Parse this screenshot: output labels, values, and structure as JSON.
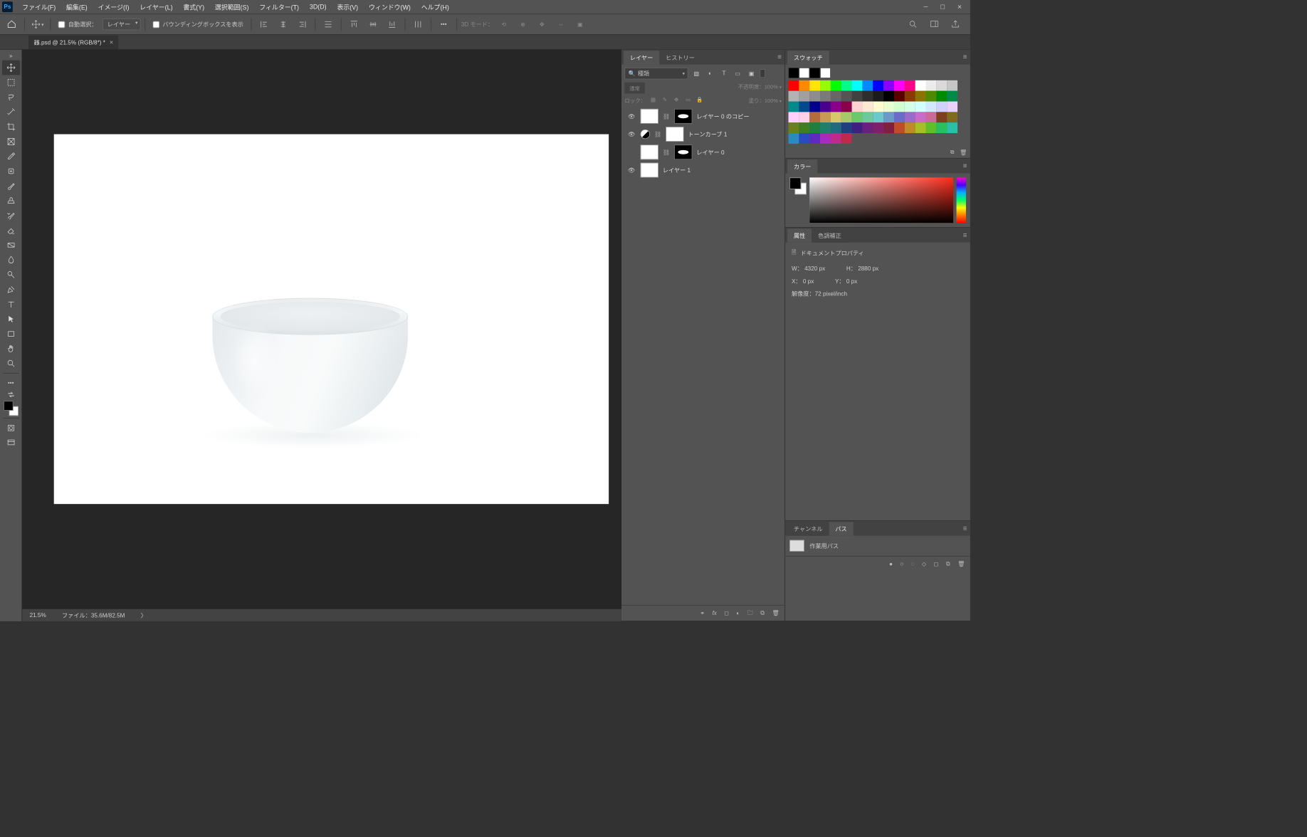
{
  "app": {
    "icon": "Ps"
  },
  "menu": [
    "ファイル(F)",
    "編集(E)",
    "イメージ(I)",
    "レイヤー(L)",
    "書式(Y)",
    "選択範囲(S)",
    "フィルター(T)",
    "3D(D)",
    "表示(V)",
    "ウィンドウ(W)",
    "ヘルプ(H)"
  ],
  "optionbar": {
    "autoSelectLabel": "自動選択：",
    "autoSelectTarget": "レイヤー",
    "showBBox": "バウンディングボックスを表示",
    "threeDMode": "3D モード："
  },
  "document": {
    "tabTitle": "器.psd @ 21.5% (RGB/8*) *"
  },
  "status": {
    "zoom": "21.5%",
    "info": "ファイル：35.6M/82.5M"
  },
  "layersPanel": {
    "tabLayers": "レイヤー",
    "tabHistory": "ヒストリー",
    "filterKind": "種類",
    "blendMode": "通常",
    "opacityLabel": "不透明度：",
    "opacityValue": "100%",
    "lockLabel": "ロック：",
    "fillLabel": "塗り：",
    "fillValue": "100%",
    "layers": [
      {
        "name": "レイヤー 0 のコピー",
        "hasMask": true,
        "maskStyle": "blob",
        "visible": true,
        "thumb": "white",
        "adj": false
      },
      {
        "name": "トーンカーブ 1",
        "hasMask": true,
        "maskStyle": "white",
        "visible": true,
        "thumb": "adj",
        "adj": true
      },
      {
        "name": "レイヤー 0",
        "hasMask": true,
        "maskStyle": "blob",
        "visible": false,
        "thumb": "white",
        "adj": false
      },
      {
        "name": "レイヤー 1",
        "hasMask": false,
        "visible": true,
        "thumb": "white",
        "adj": false
      }
    ]
  },
  "swatchesPanel": {
    "tab": "スウォッチ",
    "preset": [
      "#000000",
      "#ffffff",
      "#000000",
      "#ffffff"
    ],
    "colors": [
      "#ff0000",
      "#ff8a00",
      "#ffe600",
      "#95ff00",
      "#00ff00",
      "#00ff8a",
      "#00ffff",
      "#008aff",
      "#0000ff",
      "#8a00ff",
      "#ff00ff",
      "#ff008a",
      "#ffffff",
      "#ececec",
      "#d9d9d9",
      "#c6c6c6",
      "#b3b3b3",
      "#a0a0a0",
      "#8d8d8d",
      "#7a7a7a",
      "#676767",
      "#545454",
      "#414141",
      "#2e2e2e",
      "#1b1b1b",
      "#000000",
      "#5b0000",
      "#8a3a00",
      "#8a7300",
      "#4e8a00",
      "#008a00",
      "#008a49",
      "#008a8a",
      "#00498a",
      "#00008a",
      "#49008a",
      "#8a008a",
      "#8a0049",
      "#ffd1d1",
      "#ffe8d1",
      "#fffbd1",
      "#eaffd1",
      "#d1ffd1",
      "#d1ffe8",
      "#d1ffff",
      "#d1e8ff",
      "#d1d1ff",
      "#e8d1ff",
      "#ffd1ff",
      "#ffd1e8",
      "#b56b3e",
      "#c79a55",
      "#d6c96b",
      "#a8c96b",
      "#6bc96b",
      "#6bc99a",
      "#6bc9c9",
      "#6b9ac9",
      "#6b6bc9",
      "#9a6bc9",
      "#c96bc9",
      "#c96b9a",
      "#7f3f1f",
      "#7f6b1f",
      "#6b7f1f",
      "#3f7f1f",
      "#1f7f3f",
      "#1f7f6b",
      "#1f6b7f",
      "#1f3f7f",
      "#3f1f7f",
      "#6b1f7f",
      "#7f1f6b",
      "#7f1f3f",
      "#bf4b2a",
      "#bf8b2a",
      "#a8bf2a",
      "#5ebf2a",
      "#2abf5e",
      "#2abfa8",
      "#2a8bbf",
      "#2a4bbf",
      "#5e2abf",
      "#a82abf",
      "#bf2a8b",
      "#bf2a4b"
    ]
  },
  "colorPanel": {
    "tab": "カラー"
  },
  "propsPanel": {
    "tabProps": "属性",
    "tabAdjust": "色調補正",
    "title": "ドキュメントプロパティ",
    "w": "W： 4320 px",
    "h": "H： 2880 px",
    "x": "X： 0 px",
    "y": "Y： 0 px",
    "res": "解像度：72 pixel/inch"
  },
  "pathsPanel": {
    "tabChannels": "チャンネル",
    "tabPaths": "パス",
    "item": "作業用パス"
  }
}
